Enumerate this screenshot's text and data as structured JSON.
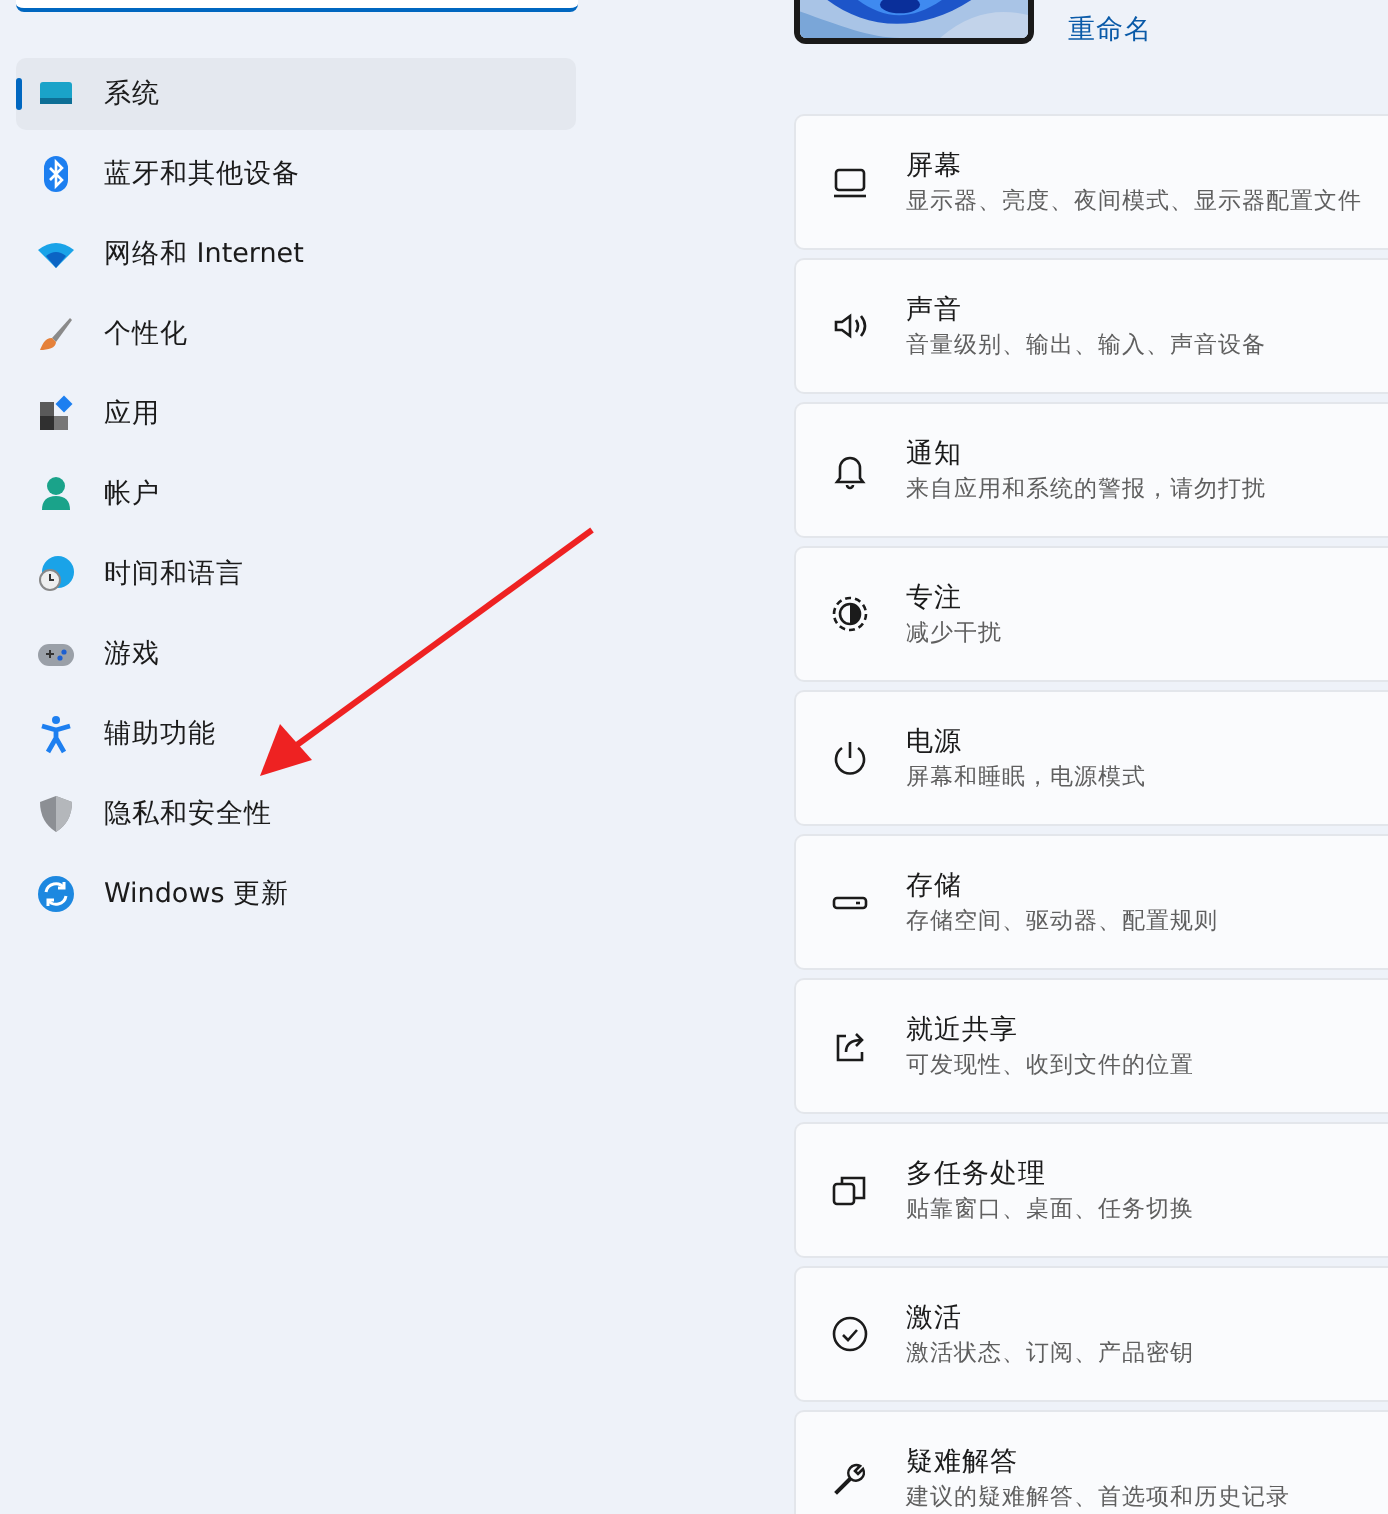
{
  "nav": {
    "items": [
      {
        "label": "系统",
        "selected": true
      },
      {
        "label": "蓝牙和其他设备",
        "selected": false
      },
      {
        "label": "网络和 Internet",
        "selected": false
      },
      {
        "label": "个性化",
        "selected": false
      },
      {
        "label": "应用",
        "selected": false
      },
      {
        "label": "帐户",
        "selected": false
      },
      {
        "label": "时间和语言",
        "selected": false
      },
      {
        "label": "游戏",
        "selected": false
      },
      {
        "label": "辅助功能",
        "selected": false
      },
      {
        "label": "隐私和安全性",
        "selected": false
      },
      {
        "label": "Windows 更新",
        "selected": false
      }
    ]
  },
  "device": {
    "rename_link": "重命名"
  },
  "settings": [
    {
      "title": "屏幕",
      "subtitle": "显示器、亮度、夜间模式、显示器配置文件"
    },
    {
      "title": "声音",
      "subtitle": "音量级别、输出、输入、声音设备"
    },
    {
      "title": "通知",
      "subtitle": "来自应用和系统的警报，请勿打扰"
    },
    {
      "title": "专注",
      "subtitle": "减少干扰"
    },
    {
      "title": "电源",
      "subtitle": "屏幕和睡眠，电源模式"
    },
    {
      "title": "存储",
      "subtitle": "存储空间、驱动器、配置规则"
    },
    {
      "title": "就近共享",
      "subtitle": "可发现性、收到文件的位置"
    },
    {
      "title": "多任务处理",
      "subtitle": "贴靠窗口、桌面、任务切换"
    },
    {
      "title": "激活",
      "subtitle": "激活状态、订阅、产品密钥"
    },
    {
      "title": "疑难解答",
      "subtitle": "建议的疑难解答、首选项和历史记录"
    }
  ],
  "annotation": {
    "kind": "arrow"
  }
}
